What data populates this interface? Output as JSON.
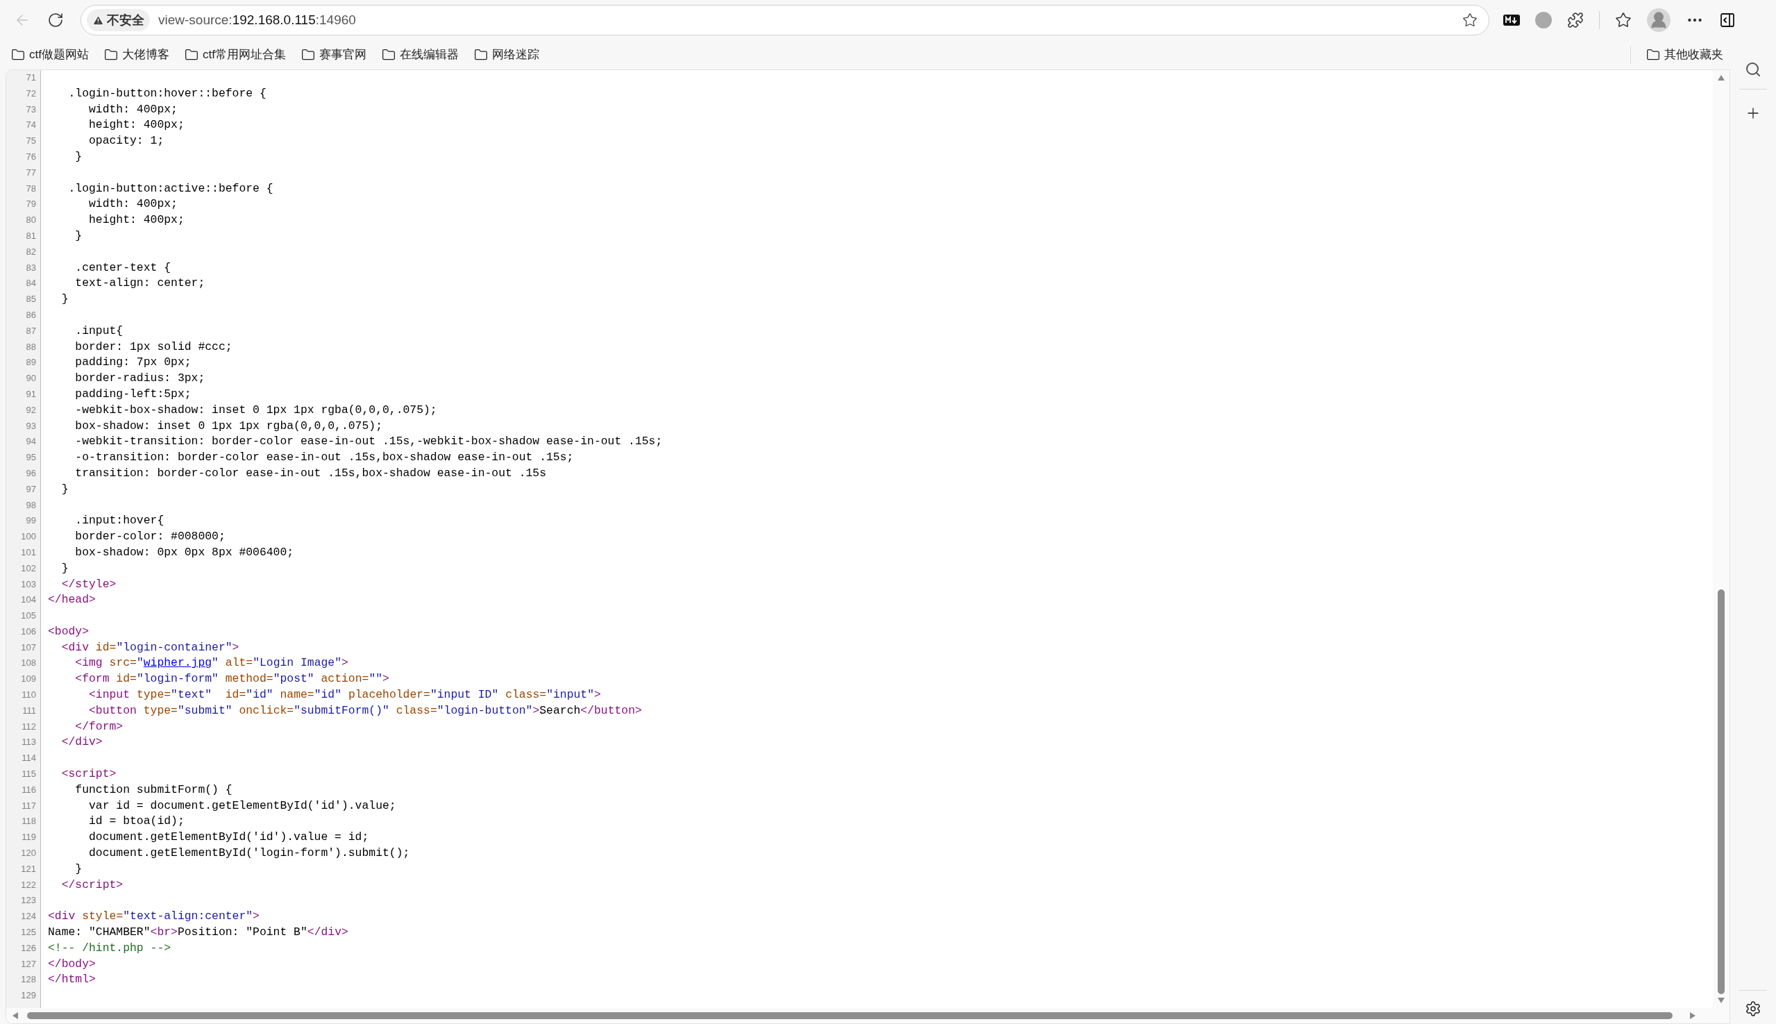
{
  "toolbar": {
    "back": {
      "disabled": true
    },
    "security": {
      "label": "不安全"
    },
    "address": {
      "scheme": "view-source:",
      "host": "192.168.0.115",
      "port": ":14960"
    }
  },
  "bookmarks": [
    {
      "label": "ctf做题网站"
    },
    {
      "label": "大佬博客"
    },
    {
      "label": "ctf常用网址合集"
    },
    {
      "label": "赛事官网"
    },
    {
      "label": "在线编辑器"
    },
    {
      "label": "网络迷踪"
    }
  ],
  "other_bookmarks": {
    "label": "其他收藏夹"
  },
  "source_lines": [
    {
      "number": "71"
    },
    {
      "number": "72",
      "tokens": [
        {
          "kind": "text",
          "text": "   .login-button:hover::before {"
        }
      ]
    },
    {
      "number": "73",
      "tokens": [
        {
          "kind": "text",
          "text": "      width: 400px;"
        }
      ]
    },
    {
      "number": "74",
      "tokens": [
        {
          "kind": "text",
          "text": "      height: 400px;"
        }
      ]
    },
    {
      "number": "75",
      "tokens": [
        {
          "kind": "text",
          "text": "      opacity: 1;"
        }
      ]
    },
    {
      "number": "76",
      "tokens": [
        {
          "kind": "text",
          "text": "    }"
        }
      ]
    },
    {
      "number": "77"
    },
    {
      "number": "78",
      "tokens": [
        {
          "kind": "text",
          "text": "   .login-button:active::before {"
        }
      ]
    },
    {
      "number": "79",
      "tokens": [
        {
          "kind": "text",
          "text": "      width: 400px;"
        }
      ]
    },
    {
      "number": "80",
      "tokens": [
        {
          "kind": "text",
          "text": "      height: 400px;"
        }
      ]
    },
    {
      "number": "81",
      "tokens": [
        {
          "kind": "text",
          "text": "    }"
        }
      ]
    },
    {
      "number": "82"
    },
    {
      "number": "83",
      "tokens": [
        {
          "kind": "text",
          "text": "    .center-text {"
        }
      ]
    },
    {
      "number": "84",
      "tokens": [
        {
          "kind": "text",
          "text": "    text-align: center;"
        }
      ]
    },
    {
      "number": "85",
      "tokens": [
        {
          "kind": "text",
          "text": "  }"
        }
      ]
    },
    {
      "number": "86"
    },
    {
      "number": "87",
      "tokens": [
        {
          "kind": "text",
          "text": "    .input{"
        }
      ]
    },
    {
      "number": "88",
      "tokens": [
        {
          "kind": "text",
          "text": "    border: 1px solid #ccc;"
        }
      ]
    },
    {
      "number": "89",
      "tokens": [
        {
          "kind": "text",
          "text": "    padding: 7px 0px;"
        }
      ]
    },
    {
      "number": "90",
      "tokens": [
        {
          "kind": "text",
          "text": "    border-radius: 3px;"
        }
      ]
    },
    {
      "number": "91",
      "tokens": [
        {
          "kind": "text",
          "text": "    padding-left:5px;"
        }
      ]
    },
    {
      "number": "92",
      "tokens": [
        {
          "kind": "text",
          "text": "    -webkit-box-shadow: inset 0 1px 1px rgba(0,0,0,.075);"
        }
      ]
    },
    {
      "number": "93",
      "tokens": [
        {
          "kind": "text",
          "text": "    box-shadow: inset 0 1px 1px rgba(0,0,0,.075);"
        }
      ]
    },
    {
      "number": "94",
      "tokens": [
        {
          "kind": "text",
          "text": "    -webkit-transition: border-color ease-in-out .15s,-webkit-box-shadow ease-in-out .15s;"
        }
      ]
    },
    {
      "number": "95",
      "tokens": [
        {
          "kind": "text",
          "text": "    -o-transition: border-color ease-in-out .15s,box-shadow ease-in-out .15s;"
        }
      ]
    },
    {
      "number": "96",
      "tokens": [
        {
          "kind": "text",
          "text": "    transition: border-color ease-in-out .15s,box-shadow ease-in-out .15s"
        }
      ]
    },
    {
      "number": "97",
      "tokens": [
        {
          "kind": "text",
          "text": "  }"
        }
      ]
    },
    {
      "number": "98"
    },
    {
      "number": "99",
      "tokens": [
        {
          "kind": "text",
          "text": "    .input:hover{"
        }
      ]
    },
    {
      "number": "100",
      "tokens": [
        {
          "kind": "text",
          "text": "    border-color: #008000;"
        }
      ]
    },
    {
      "number": "101",
      "tokens": [
        {
          "kind": "text",
          "text": "    box-shadow: 0px 0px 8px #006400;"
        }
      ]
    },
    {
      "number": "102",
      "tokens": [
        {
          "kind": "text",
          "text": "  }"
        }
      ]
    },
    {
      "number": "103",
      "tokens": [
        {
          "kind": "tag",
          "text": "  </style>"
        }
      ]
    },
    {
      "number": "104",
      "tokens": [
        {
          "kind": "tag",
          "text": "</head>"
        }
      ]
    },
    {
      "number": "105"
    },
    {
      "number": "106",
      "tokens": [
        {
          "kind": "tag",
          "text": "<body>"
        }
      ]
    },
    {
      "number": "107",
      "tokens": [
        {
          "kind": "tag",
          "text": "  <div"
        },
        {
          "kind": "attr",
          "text": " id="
        },
        {
          "kind": "value",
          "text": "\"login-container\""
        },
        {
          "kind": "tag",
          "text": ">"
        }
      ]
    },
    {
      "number": "108",
      "tokens": [
        {
          "kind": "tag",
          "text": "    <img"
        },
        {
          "kind": "attr",
          "text": " src="
        },
        {
          "kind": "value",
          "text": "\""
        },
        {
          "kind": "link",
          "text": "wipher.jpg"
        },
        {
          "kind": "value",
          "text": "\""
        },
        {
          "kind": "attr",
          "text": " alt="
        },
        {
          "kind": "value",
          "text": "\"Login Image\""
        },
        {
          "kind": "tag",
          "text": ">"
        }
      ]
    },
    {
      "number": "109",
      "tokens": [
        {
          "kind": "tag",
          "text": "    <form"
        },
        {
          "kind": "attr",
          "text": " id="
        },
        {
          "kind": "value",
          "text": "\"login-form\""
        },
        {
          "kind": "attr",
          "text": " method="
        },
        {
          "kind": "value",
          "text": "\"post\""
        },
        {
          "kind": "attr",
          "text": " action="
        },
        {
          "kind": "value",
          "text": "\"\""
        },
        {
          "kind": "tag",
          "text": ">"
        }
      ]
    },
    {
      "number": "110",
      "tokens": [
        {
          "kind": "tag",
          "text": "      <input"
        },
        {
          "kind": "attr",
          "text": " type="
        },
        {
          "kind": "value",
          "text": "\"text\""
        },
        {
          "kind": "attr",
          "text": "  id="
        },
        {
          "kind": "value",
          "text": "\"id\""
        },
        {
          "kind": "attr",
          "text": " name="
        },
        {
          "kind": "value",
          "text": "\"id\""
        },
        {
          "kind": "attr",
          "text": " placeholder="
        },
        {
          "kind": "value",
          "text": "\"input ID\""
        },
        {
          "kind": "attr",
          "text": " class="
        },
        {
          "kind": "value",
          "text": "\"input\""
        },
        {
          "kind": "tag",
          "text": ">"
        }
      ]
    },
    {
      "number": "111",
      "tokens": [
        {
          "kind": "tag",
          "text": "      <button"
        },
        {
          "kind": "attr",
          "text": " type="
        },
        {
          "kind": "value",
          "text": "\"submit\""
        },
        {
          "kind": "attr",
          "text": " onclick="
        },
        {
          "kind": "value",
          "text": "\"submitForm()\""
        },
        {
          "kind": "attr",
          "text": " class="
        },
        {
          "kind": "value",
          "text": "\"login-button\""
        },
        {
          "kind": "tag",
          "text": ">"
        },
        {
          "kind": "text",
          "text": "Search"
        },
        {
          "kind": "tag",
          "text": "</button>"
        }
      ]
    },
    {
      "number": "112",
      "tokens": [
        {
          "kind": "tag",
          "text": "    </form>"
        }
      ]
    },
    {
      "number": "113",
      "tokens": [
        {
          "kind": "tag",
          "text": "  </div>"
        }
      ]
    },
    {
      "number": "114"
    },
    {
      "number": "115",
      "tokens": [
        {
          "kind": "tag",
          "text": "  <script>"
        }
      ]
    },
    {
      "number": "116",
      "tokens": [
        {
          "kind": "text",
          "text": "    function submitForm() {"
        }
      ]
    },
    {
      "number": "117",
      "tokens": [
        {
          "kind": "text",
          "text": "      var id = document.getElementById('id').value;"
        }
      ]
    },
    {
      "number": "118",
      "tokens": [
        {
          "kind": "text",
          "text": "      id = btoa(id);"
        }
      ]
    },
    {
      "number": "119",
      "tokens": [
        {
          "kind": "text",
          "text": "      document.getElementById('id').value = id;"
        }
      ]
    },
    {
      "number": "120",
      "tokens": [
        {
          "kind": "text",
          "text": "      document.getElementById('login-form').submit();"
        }
      ]
    },
    {
      "number": "121",
      "tokens": [
        {
          "kind": "text",
          "text": "    }"
        }
      ]
    },
    {
      "number": "122",
      "tokens": [
        {
          "kind": "tag",
          "text": "  </script>"
        }
      ]
    },
    {
      "number": "123"
    },
    {
      "number": "124",
      "tokens": [
        {
          "kind": "tag",
          "text": "<div"
        },
        {
          "kind": "attr",
          "text": " style="
        },
        {
          "kind": "value",
          "text": "\"text-align:center\""
        },
        {
          "kind": "tag",
          "text": ">"
        }
      ]
    },
    {
      "number": "125",
      "tokens": [
        {
          "kind": "text",
          "text": "Name: \"CHAMBER\""
        },
        {
          "kind": "tag",
          "text": "<br>"
        },
        {
          "kind": "text",
          "text": "Position: \"Point B\""
        },
        {
          "kind": "tag",
          "text": "</div>"
        }
      ]
    },
    {
      "number": "126",
      "tokens": [
        {
          "kind": "comment",
          "text": "<!-- /hint.php -->"
        }
      ]
    },
    {
      "number": "127",
      "tokens": [
        {
          "kind": "tag",
          "text": "</body>"
        }
      ]
    },
    {
      "number": "128",
      "tokens": [
        {
          "kind": "tag",
          "text": "</html>"
        }
      ]
    },
    {
      "number": "129"
    }
  ]
}
